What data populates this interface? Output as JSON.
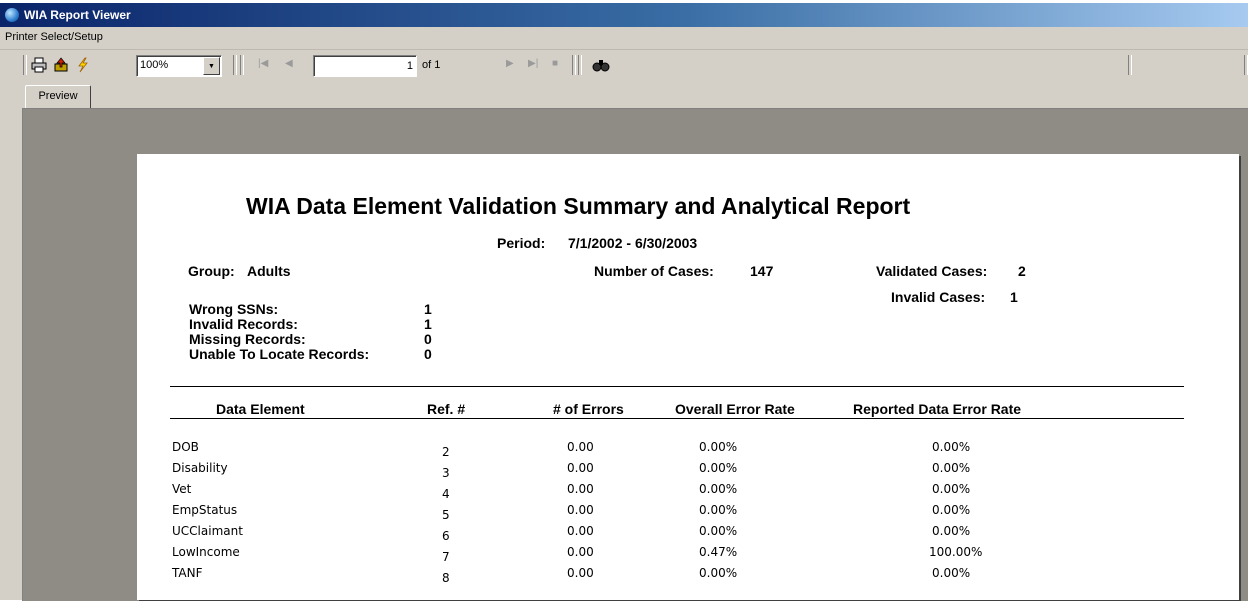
{
  "window": {
    "title": "WIA Report Viewer"
  },
  "menu": {
    "items": [
      "Printer Select/Setup"
    ]
  },
  "toolbar": {
    "zoom_value": "100%",
    "page_current": "1",
    "page_total_label": "of 1"
  },
  "tabs": [
    "Preview"
  ],
  "report": {
    "title": "WIA Data Element Validation Summary and Analytical Report",
    "period_label": "Period:",
    "period_value": "7/1/2002 - 6/30/2003",
    "group_label": "Group:",
    "group_value": "Adults",
    "num_cases_label": "Number of Cases:",
    "num_cases_value": "147",
    "validated_label": "Validated Cases:",
    "validated_value": "2",
    "invalid_cases_label": "Invalid Cases:",
    "invalid_cases_value": "1",
    "stats": [
      {
        "label": "Wrong SSNs:",
        "value": "1"
      },
      {
        "label": "Invalid Records:",
        "value": "1"
      },
      {
        "label": "Missing Records:",
        "value": "0"
      },
      {
        "label": "Unable To Locate Records:",
        "value": "0"
      }
    ],
    "columns": [
      "Data Element",
      "Ref. #",
      "# of Errors",
      "Overall Error Rate",
      "Reported Data Error Rate"
    ],
    "rows": [
      {
        "element": "DOB",
        "ref": "2",
        "errors": "0.00",
        "overall": "0.00%",
        "reported": "0.00%"
      },
      {
        "element": "Disability",
        "ref": "3",
        "errors": "0.00",
        "overall": "0.00%",
        "reported": "0.00%"
      },
      {
        "element": "Vet",
        "ref": "4",
        "errors": "0.00",
        "overall": "0.00%",
        "reported": "0.00%"
      },
      {
        "element": "EmpStatus",
        "ref": "5",
        "errors": "0.00",
        "overall": "0.00%",
        "reported": "0.00%"
      },
      {
        "element": "UCClaimant",
        "ref": "6",
        "errors": "0.00",
        "overall": "0.00%",
        "reported": "0.00%"
      },
      {
        "element": "LowIncome",
        "ref": "7",
        "errors": "0.00",
        "overall": "0.47%",
        "reported": "100.00%"
      },
      {
        "element": "TANF",
        "ref": "8",
        "errors": "0.00",
        "overall": "0.00%",
        "reported": "0.00%"
      }
    ]
  },
  "icons": [
    "app-icon",
    "print-icon",
    "export-icon",
    "refresh-icon",
    "first-page-icon",
    "prev-page-icon",
    "next-page-icon",
    "last-page-icon",
    "stop-icon",
    "search-icon"
  ],
  "colors": {
    "titlebar_start": "#0a246a",
    "titlebar_end": "#a6caf0",
    "chrome": "#d4d0c8",
    "preview_bg": "#8e8c84"
  }
}
